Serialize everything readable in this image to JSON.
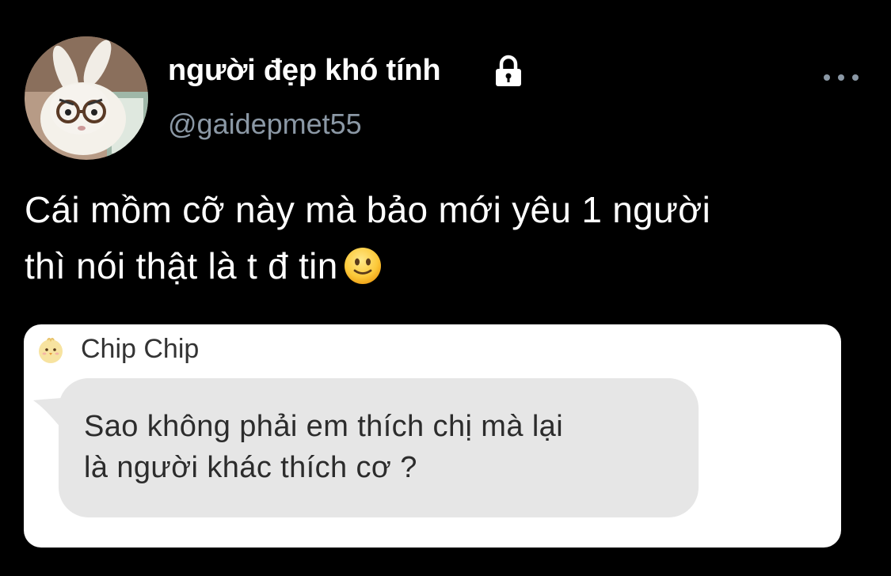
{
  "tweet": {
    "author": {
      "display_name": "người đẹp khó tính",
      "handle": "@gaidepmet55",
      "avatar_icon": "plush-bunny-with-glasses-avatar",
      "protected_icon": "lock-icon"
    },
    "more_icon": "ellipsis-icon",
    "text_line_1": "Cái mồm cỡ này mà bảo mới yêu 1 người",
    "text_line_2": "thì nói thật là t đ tin",
    "emoji": "slightly-smiling-face-emoji"
  },
  "screenshot": {
    "sender_avatar_icon": "chick-avatar-icon",
    "sender_name": "Chip Chip",
    "message_line_1": "Sao không phải em thích chị mà lại",
    "message_line_2": "là người khác thích cơ ?"
  },
  "colors": {
    "background": "#000000",
    "display_name": "#ffffff",
    "handle": "#8b98a5",
    "card_background": "#ffffff",
    "bubble_background": "#e6e6e6",
    "bubble_text": "#2c2c2c"
  }
}
